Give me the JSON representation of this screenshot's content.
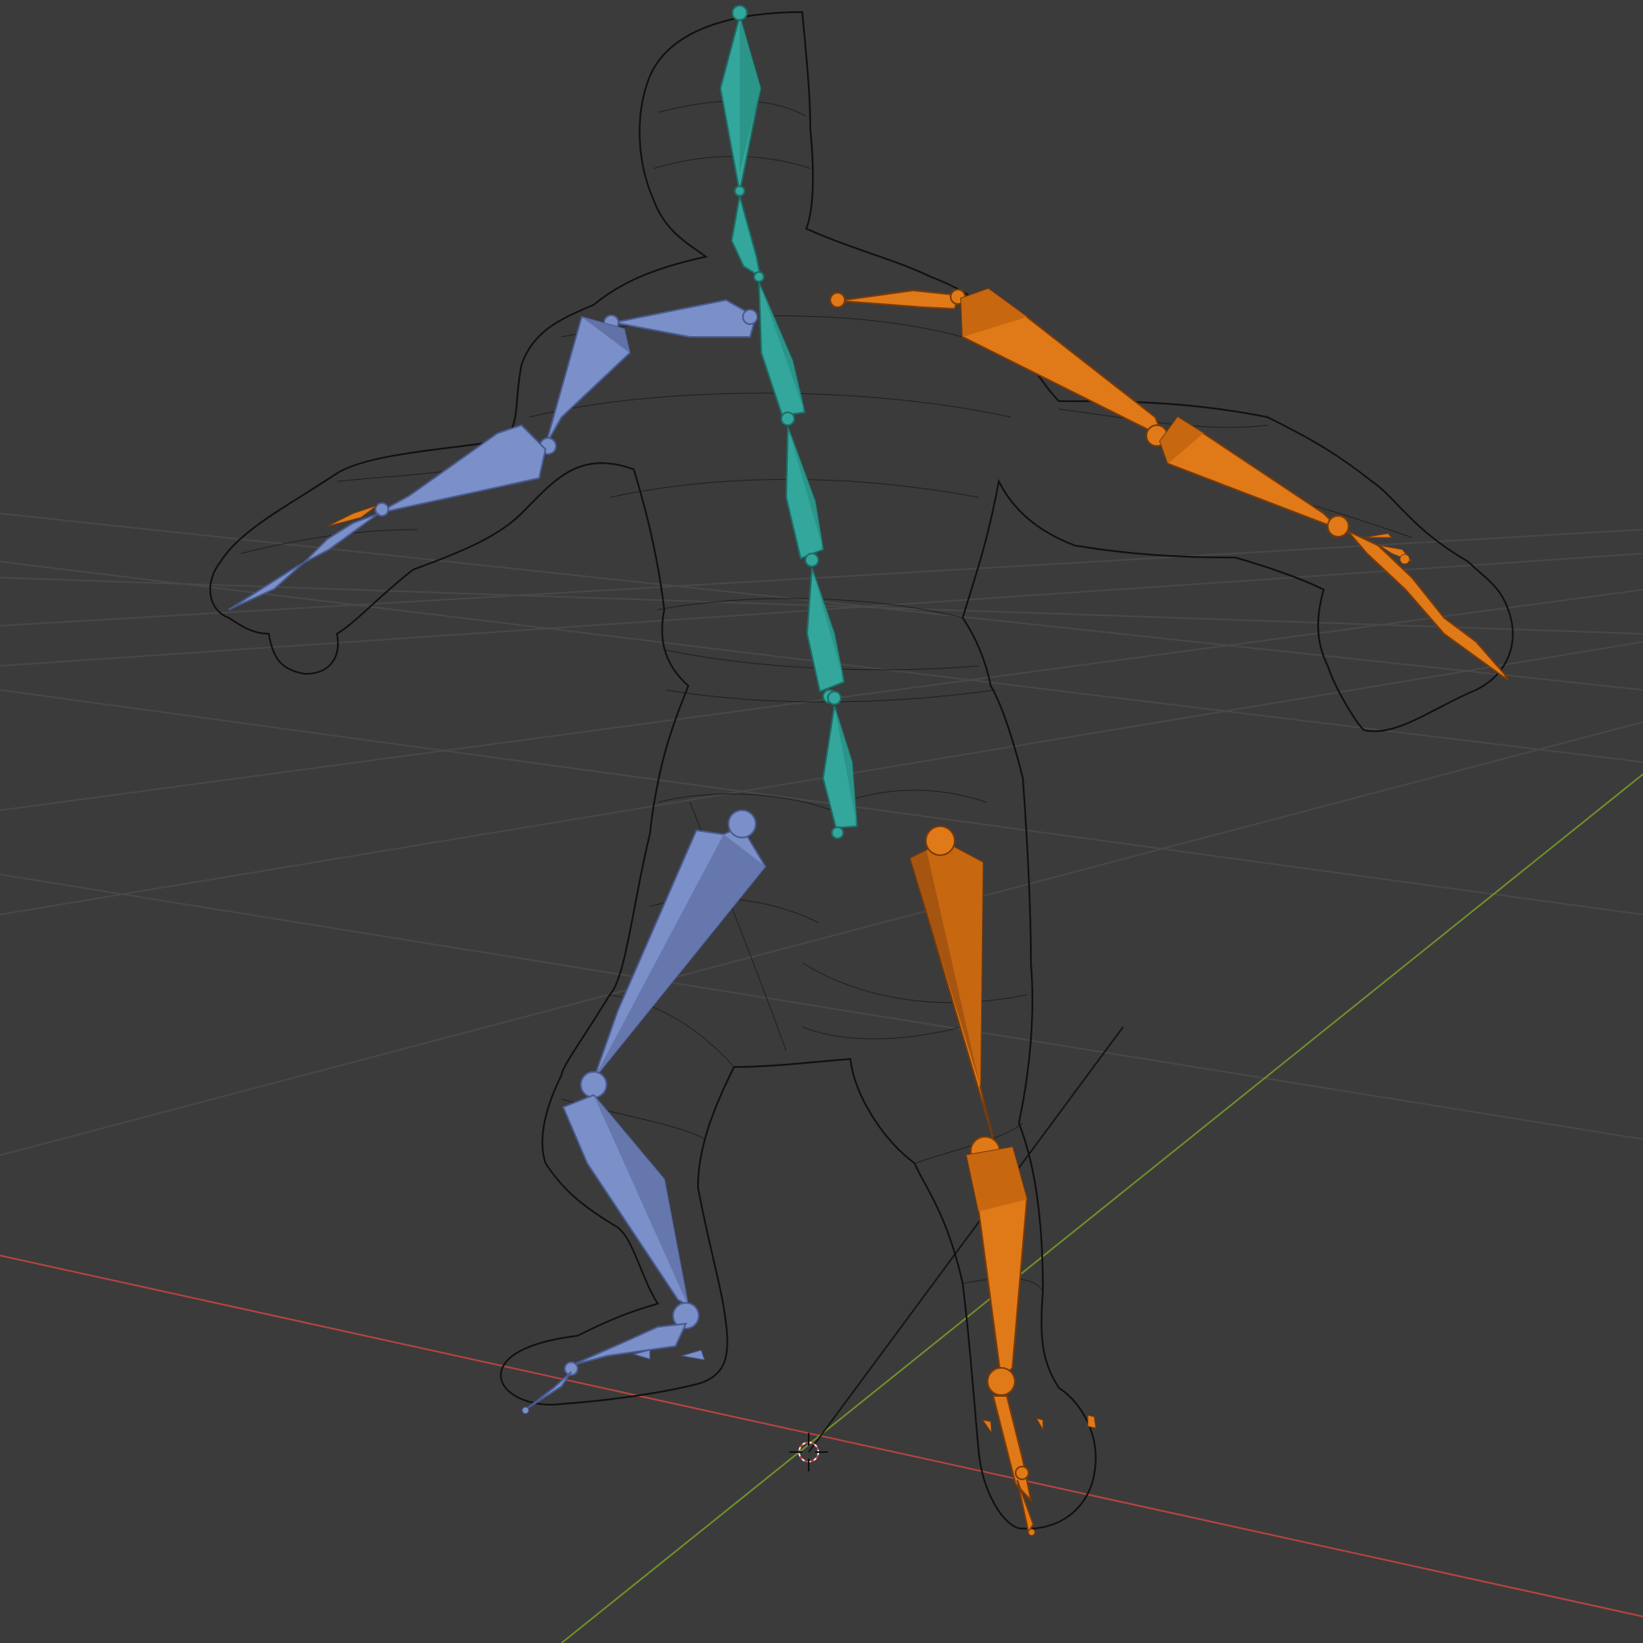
{
  "viewport": {
    "background": "#3b3b3b",
    "grid_color": "#474747",
    "x_axis_color": "#c9413f",
    "y_axis_color": "#7a9a2c",
    "icon": "3d-cursor-icon"
  },
  "mesh": {
    "wire_color": "#111111",
    "icon": "wireframe-character-icon"
  },
  "armature": {
    "center_color": "#33a79c",
    "left_color": "#7b8fc8",
    "right_color": "#e07a18",
    "bones": [
      {
        "id": "bone-head",
        "side": "center"
      },
      {
        "id": "bone-neck",
        "side": "center"
      },
      {
        "id": "bone-spine-upper",
        "side": "center"
      },
      {
        "id": "bone-spine-mid",
        "side": "center"
      },
      {
        "id": "bone-spine-lower",
        "side": "center"
      },
      {
        "id": "bone-hips",
        "side": "center"
      },
      {
        "id": "bone-pelvis",
        "side": "center"
      },
      {
        "id": "bone-clavicle-left",
        "side": "left"
      },
      {
        "id": "bone-upper-arm-left",
        "side": "left"
      },
      {
        "id": "bone-forearm-left",
        "side": "left"
      },
      {
        "id": "bone-hand-left",
        "side": "left"
      },
      {
        "id": "bone-thigh-left",
        "side": "left"
      },
      {
        "id": "bone-shin-left",
        "side": "left"
      },
      {
        "id": "bone-foot-left",
        "side": "left"
      },
      {
        "id": "bone-toe-left",
        "side": "left"
      },
      {
        "id": "bone-clavicle-right",
        "side": "right"
      },
      {
        "id": "bone-upper-arm-right",
        "side": "right"
      },
      {
        "id": "bone-forearm-right",
        "side": "right"
      },
      {
        "id": "bone-hand-right",
        "side": "right"
      },
      {
        "id": "bone-thigh-right",
        "side": "right"
      },
      {
        "id": "bone-shin-right",
        "side": "right"
      },
      {
        "id": "bone-foot-right",
        "side": "right"
      }
    ]
  }
}
